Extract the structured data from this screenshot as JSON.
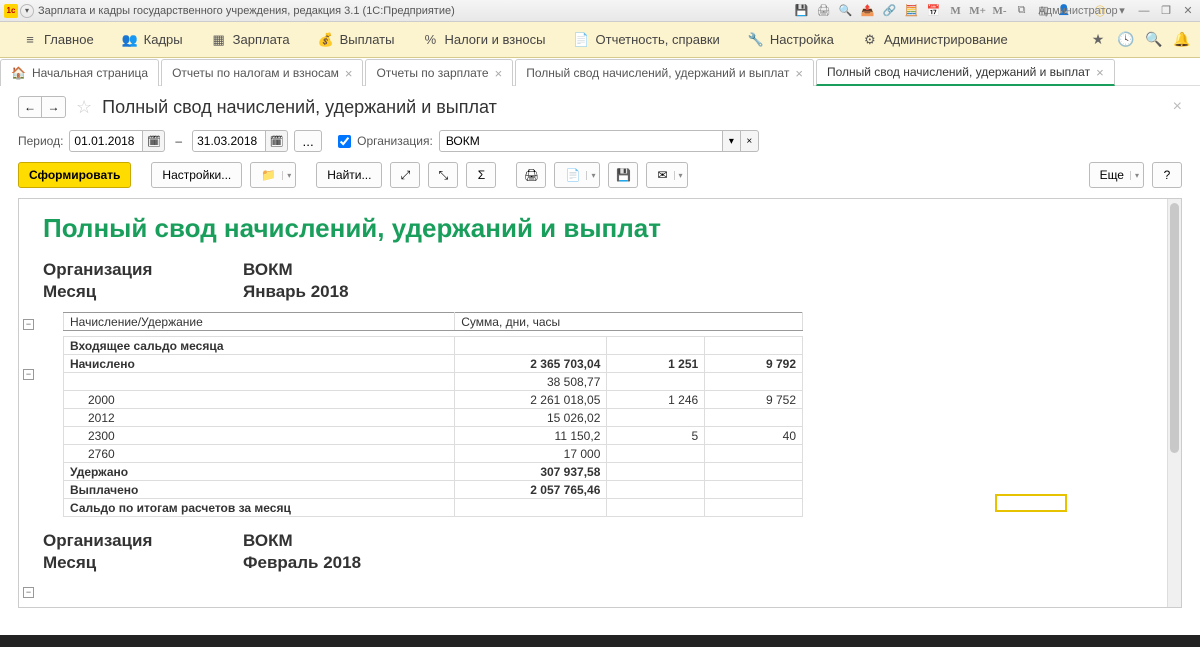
{
  "titlebar": {
    "title": "Зарплата и кадры государственного учреждения, редакция 3.1  (1С:Предприятие)",
    "user": "Администратор",
    "m_buttons": [
      "M",
      "M+",
      "M-"
    ]
  },
  "mainmenu": {
    "items": [
      {
        "icon": "≡",
        "label": "Главное"
      },
      {
        "icon": "👥",
        "label": "Кадры"
      },
      {
        "icon": "▦",
        "label": "Зарплата"
      },
      {
        "icon": "💰",
        "label": "Выплаты"
      },
      {
        "icon": "%",
        "label": "Налоги и взносы"
      },
      {
        "icon": "📄",
        "label": "Отчетность, справки"
      },
      {
        "icon": "🔧",
        "label": "Настройка"
      },
      {
        "icon": "⚙",
        "label": "Администрирование"
      }
    ]
  },
  "tabs": [
    {
      "label": "Начальная страница",
      "home": true
    },
    {
      "label": "Отчеты по налогам и взносам",
      "closable": true
    },
    {
      "label": "Отчеты по зарплате",
      "closable": true
    },
    {
      "label": "Полный свод начислений, удержаний и выплат",
      "closable": true
    },
    {
      "label": "Полный свод начислений, удержаний и выплат",
      "closable": true,
      "active": true
    }
  ],
  "page_title": "Полный свод начислений, удержаний и выплат",
  "filters": {
    "period_label": "Период:",
    "date_from": "01.01.2018",
    "date_to": "31.03.2018",
    "dots": "...",
    "org_label": "Организация:",
    "org_value": "ВОКМ",
    "dash": "–"
  },
  "toolbar": {
    "form": "Сформировать",
    "settings": "Настройки...",
    "find": "Найти...",
    "more": "Еще",
    "help": "?"
  },
  "report": {
    "title": "Полный свод начислений, удержаний и выплат",
    "org_label": "Организация",
    "month_label": "Месяц",
    "blocks": [
      {
        "org": "ВОКМ",
        "month": "Январь 2018"
      },
      {
        "org": "ВОКМ",
        "month": "Февраль 2018"
      }
    ],
    "table": {
      "hdr_left": "Начисление/Удержание",
      "hdr_right": "Сумма, дни, часы",
      "rows": [
        {
          "name": "Входящее сальдо месяца",
          "bold": true
        },
        {
          "name": "Начислено",
          "bold": true,
          "sum": "2 365 703,04",
          "c2": "1 251",
          "c3": "9 792"
        },
        {
          "name": "",
          "sum": "38 508,77"
        },
        {
          "name": "2000",
          "indent": true,
          "sum": "2 261 018,05",
          "c2": "1 246",
          "c3": "9 752"
        },
        {
          "name": "2012",
          "indent": true,
          "sum": "15 026,02"
        },
        {
          "name": "2300",
          "indent": true,
          "sum": "11 150,2",
          "c2": "5",
          "c3": "40"
        },
        {
          "name": "2760",
          "indent": true,
          "sum": "17 000"
        },
        {
          "name": "Удержано",
          "bold": true,
          "sum": "307 937,58"
        },
        {
          "name": "Выплачено",
          "bold": true,
          "sum": "2 057 765,46"
        },
        {
          "name": "Сальдо по итогам расчетов за месяц",
          "bold": true
        }
      ]
    }
  }
}
